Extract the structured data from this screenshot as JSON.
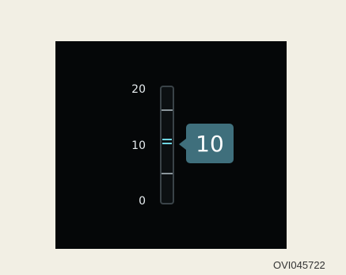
{
  "gauge": {
    "scale_labels": [
      "20",
      "10",
      "0"
    ],
    "current_value": "10",
    "level": 10,
    "min": 0,
    "max": 20,
    "colors": {
      "background": "#f2efe4",
      "screen": "#050708",
      "bubble": "#3f6f7c",
      "level_mark": "#6fd6e3"
    }
  },
  "figure_code": "OVI045722"
}
